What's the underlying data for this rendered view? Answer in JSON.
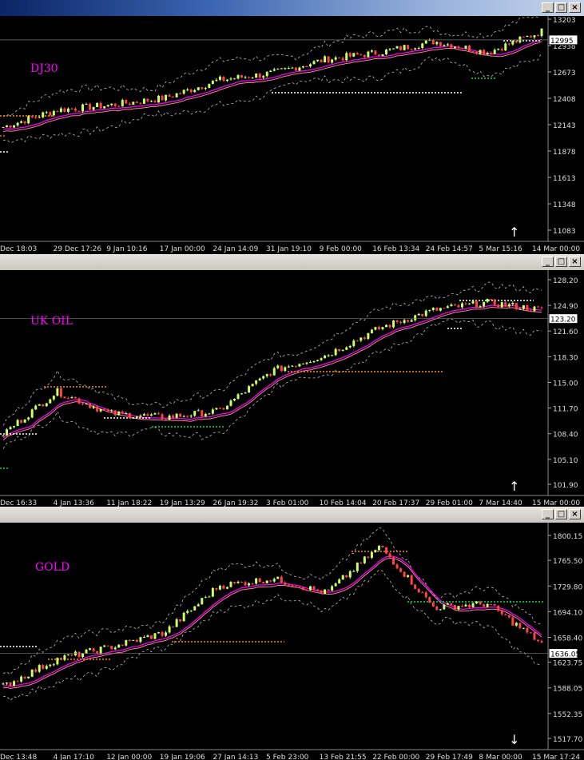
{
  "windows": [
    {
      "symbol": "DJ30",
      "arrow": "↑",
      "price_label": "12995",
      "ylim": [
        11083,
        13203
      ],
      "ticks": [
        "13203",
        "12938",
        "12673",
        "12408",
        "12143",
        "11878",
        "11613",
        "11348",
        "11083"
      ],
      "xticks": [
        "Dec 18:03",
        "29 Dec 17:26",
        "9 Jan 10:16",
        "17 Jan 00:00",
        "24 Jan 14:09",
        "31 Jan 19:10",
        "9 Feb 00:00",
        "16 Feb 13:34",
        "24 Feb 14:57",
        "5 Mar 15:16",
        "14 Mar 00:00"
      ]
    },
    {
      "symbol": "UK OIL",
      "arrow": "↑",
      "price_label": "123.20",
      "ylim": [
        101.9,
        128.2
      ],
      "ticks": [
        "128.20",
        "124.90",
        "121.60",
        "118.30",
        "115.00",
        "111.70",
        "108.40",
        "105.10",
        "101.90"
      ],
      "xticks": [
        "Dec 16:33",
        "4 Jan 13:36",
        "11 Jan 18:22",
        "19 Jan 13:29",
        "26 Jan 19:32",
        "3 Feb 01:00",
        "10 Feb 14:04",
        "20 Feb 17:37",
        "29 Feb 01:00",
        "7 Mar 14:40",
        "15 Mar 00:00"
      ]
    },
    {
      "symbol": "GOLD",
      "arrow": "↓",
      "price_label": "1636.05",
      "ylim": [
        1517.7,
        1800.15
      ],
      "ticks": [
        "1800.15",
        "1765.50",
        "1729.80",
        "1694.10",
        "1658.40",
        "1623.75",
        "1588.05",
        "1552.35",
        "1517.70"
      ],
      "xticks": [
        "Dec 13:48",
        "4 Jan 17:10",
        "12 Jan 00:00",
        "19 Jan 19:06",
        "27 Jan 14:13",
        "5 Feb 23:00",
        "13 Feb 21:55",
        "22 Feb 00:00",
        "29 Feb 17:49",
        "8 Mar 00:00",
        "15 Mar 17:24"
      ]
    }
  ],
  "chart_data": [
    {
      "type": "line",
      "title": "DJ30",
      "ylim": [
        11083,
        13203
      ],
      "x": [
        "Dec 18:03",
        "29 Dec 17:26",
        "9 Jan 10:16",
        "17 Jan 00:00",
        "24 Jan 14:09",
        "31 Jan 19:10",
        "9 Feb 00:00",
        "16 Feb 13:34",
        "24 Feb 14:57",
        "5 Mar 15:16",
        "14 Mar 00:00"
      ],
      "series": [
        {
          "values": [
            12120,
            12290,
            12340,
            12410,
            12590,
            12660,
            12800,
            12870,
            12980,
            12870,
            13080
          ]
        }
      ],
      "last": 12995
    },
    {
      "type": "line",
      "title": "UK OIL",
      "ylim": [
        101.9,
        128.2
      ],
      "x": [
        "Dec 16:33",
        "4 Jan 13:36",
        "11 Jan 18:22",
        "19 Jan 13:29",
        "26 Jan 19:32",
        "3 Feb 01:00",
        "10 Feb 14:04",
        "20 Feb 17:37",
        "29 Feb 01:00",
        "7 Mar 14:40",
        "15 Mar 00:00"
      ],
      "series": [
        {
          "values": [
            108.4,
            113.8,
            111.0,
            110.5,
            111.3,
            116.5,
            118.5,
            122.0,
            124.3,
            125.3,
            124.3
          ]
        }
      ],
      "last": 123.2
    },
    {
      "type": "line",
      "title": "GOLD",
      "ylim": [
        1517.7,
        1800.15
      ],
      "x": [
        "Dec 13:48",
        "4 Jan 17:10",
        "12 Jan 00:00",
        "19 Jan 19:06",
        "27 Jan 14:13",
        "5 Feb 23:00",
        "13 Feb 21:55",
        "22 Feb 00:00",
        "29 Feb 17:49",
        "8 Mar 00:00",
        "15 Mar 17:24"
      ],
      "series": [
        {
          "values": [
            1590,
            1628,
            1645,
            1665,
            1730,
            1740,
            1720,
            1785,
            1700,
            1705,
            1650
          ]
        }
      ],
      "last": 1636.05
    }
  ],
  "colors": {
    "background": "#000000",
    "candle_up": "#ccff66",
    "candle_down": "#ff4444",
    "ma_magenta": "#ff00ff",
    "ma_pink": "#ff7aa0",
    "band": "#bbbbbb",
    "level_orange": "#ff8c00",
    "level_white": "#ffffff",
    "level_green": "#00dd44",
    "label_magenta": "#ff00ff"
  },
  "window_buttons": {
    "minimize": "_",
    "maximize": "□",
    "close": "×"
  }
}
